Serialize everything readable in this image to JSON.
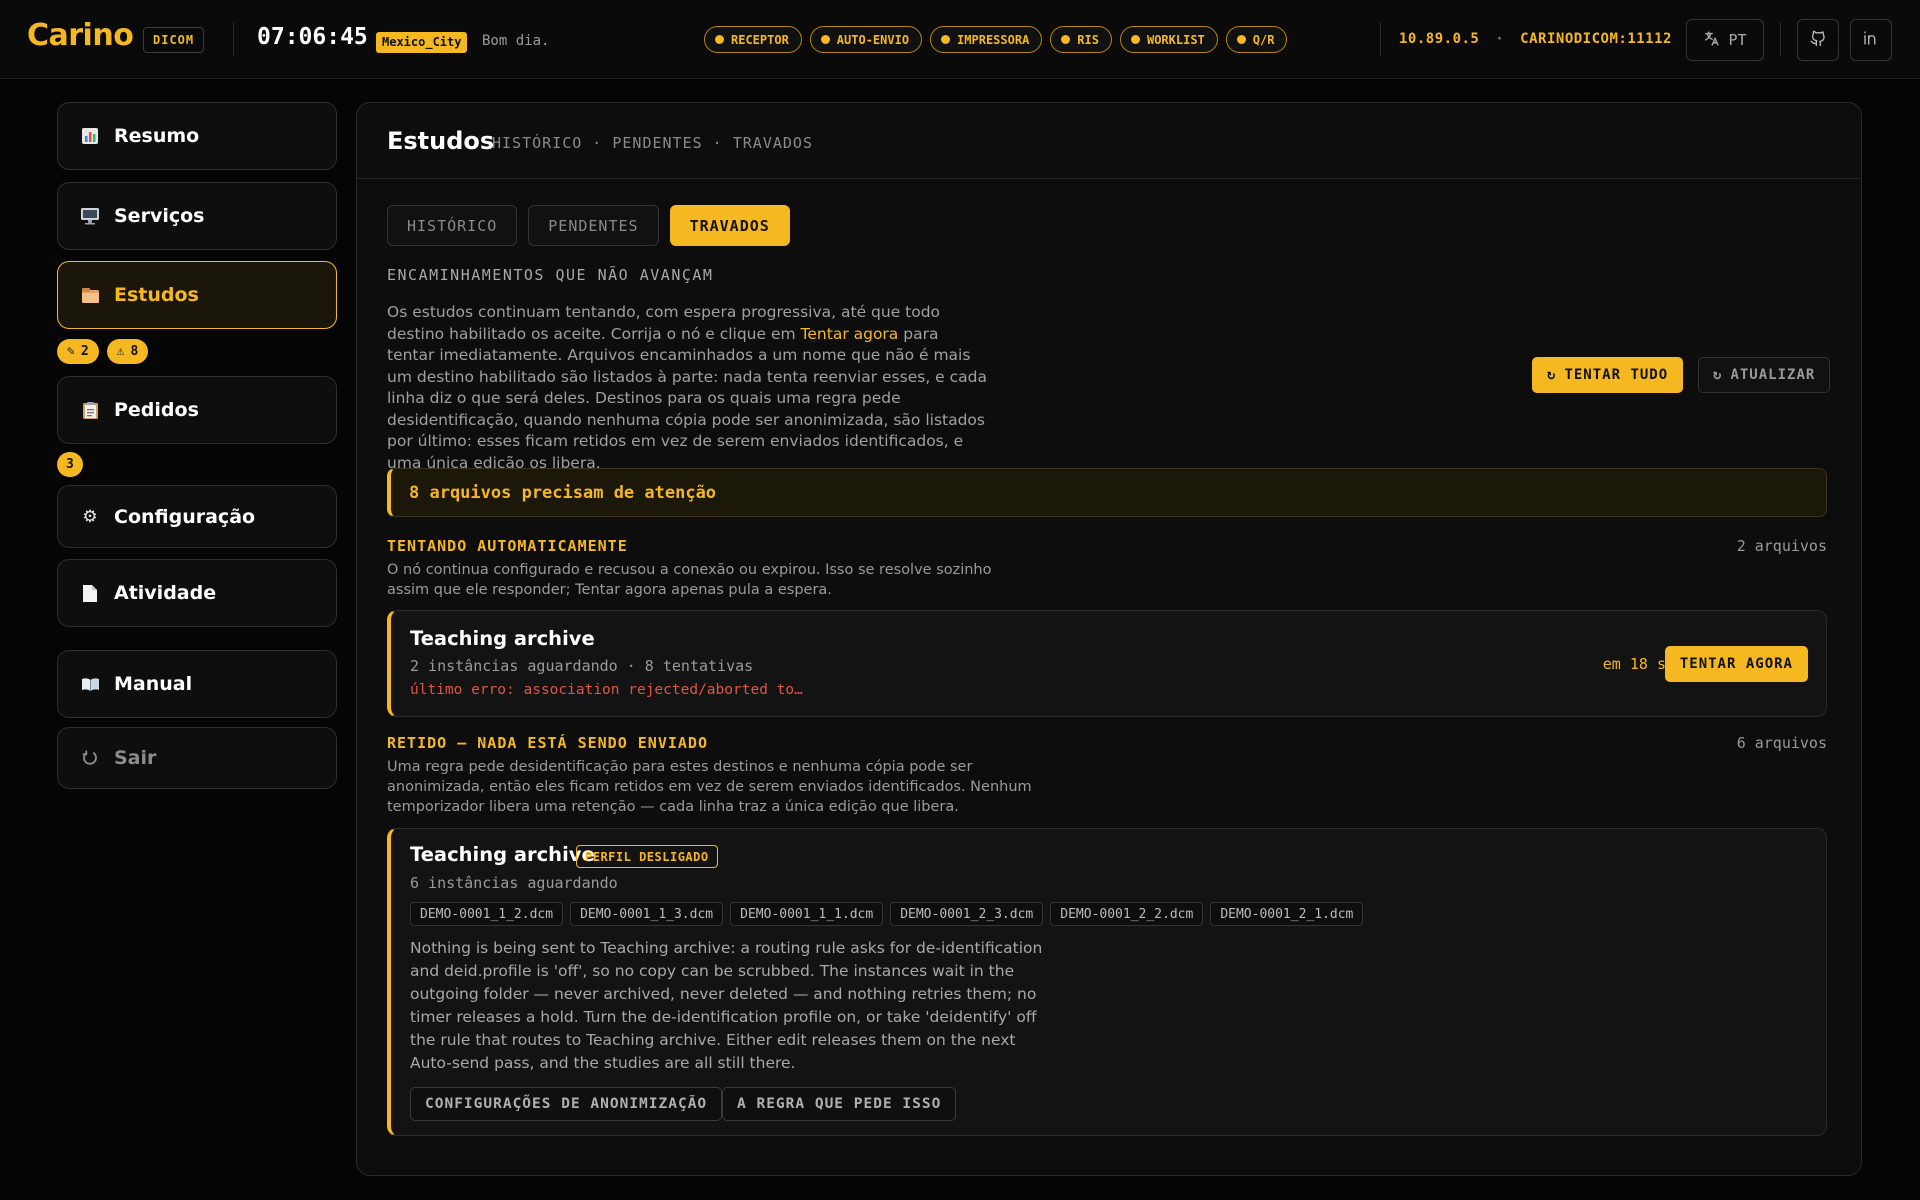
{
  "app": {
    "brand": "Carino",
    "brand_tag": "DICOM",
    "clock": "07:06:45",
    "timezone": "Mexico_City",
    "greeting": "Bom dia.",
    "address": "10.89.0.5",
    "address_sep": "·",
    "ae_title": "CARINODICOM:11112",
    "language": "PT",
    "accent_color": "#f5b820",
    "error_color": "#e05540"
  },
  "status_pills": [
    {
      "label": "RECEPTOR"
    },
    {
      "label": "AUTO-ENVIO"
    },
    {
      "label": "IMPRESSORA"
    },
    {
      "label": "RIS"
    },
    {
      "label": "WORKLIST"
    },
    {
      "label": "Q/R"
    }
  ],
  "sidebar": {
    "items": [
      {
        "label": "Resumo",
        "icon": "bar-chart-icon"
      },
      {
        "label": "Serviços",
        "icon": "monitor-icon"
      },
      {
        "label": "Estudos",
        "icon": "folder-icon"
      },
      {
        "label": "Pedidos",
        "icon": "clipboard-icon"
      },
      {
        "label": "Configuração",
        "icon": "gear-icon"
      },
      {
        "label": "Atividade",
        "icon": "document-icon"
      },
      {
        "label": "Manual",
        "icon": "book-icon"
      },
      {
        "label": "Sair",
        "icon": "power-icon"
      }
    ],
    "estudos_badges": [
      {
        "icon": "pencil-icon",
        "count": "2"
      },
      {
        "icon": "warning-icon",
        "count": "8"
      }
    ],
    "pedidos_badge": "3"
  },
  "main": {
    "title": "Estudos",
    "subtitle": "HISTÓRICO · PENDENTES · TRAVADOS",
    "tabs": [
      {
        "label": "HISTÓRICO"
      },
      {
        "label": "PENDENTES"
      },
      {
        "label": "TRAVADOS"
      }
    ],
    "active_tab": "TRAVADOS",
    "section_caption": "ENCAMINHAMENTOS QUE NÃO AVANÇAM",
    "intro_before": "Os estudos continuam tentando, com espera progressiva, até que todo destino habilitado os aceite. Corrija o nó e clique em ",
    "intro_link": "Tentar agora",
    "intro_after": " para tentar imediatamente. Arquivos encaminhados a um nome que não é mais um destino habilitado são listados à parte: nada tenta reenviar esses, e cada linha diz o que será deles. Destinos para os quais uma regra pede desidentificação, quando nenhuma cópia pode ser anonimizada, são listados por último: esses ficam retidos em vez de serem enviados identificados, e uma única edição os libera.",
    "retry_all": "TENTAR TUDO",
    "refresh": "ATUALIZAR",
    "attention": "8 arquivos precisam de atenção",
    "auto_group": {
      "title": "TENTANDO AUTOMATICAMENTE",
      "count": "2 arquivos",
      "desc": "O nó continua configurado e recusou a conexão ou expirou. Isso se resolve sozinho assim que ele responder; Tentar agora apenas pula a espera.",
      "card": {
        "name": "Teaching archive",
        "meta": "2 instâncias aguardando · 8 tentativas",
        "error": "último erro: association rejected/aborted to…",
        "eta": "em 18 s",
        "action": "TENTAR AGORA"
      }
    },
    "held_group": {
      "title": "RETIDO — NADA ESTÁ SENDO ENVIADO",
      "count": "6 arquivos",
      "desc": "Uma regra pede desidentificação para estes destinos e nenhuma cópia pode ser anonimizada, então eles ficam retidos em vez de serem enviados identificados. Nenhum temporizador libera uma retenção — cada linha traz a única edição que libera.",
      "card": {
        "name": "Teaching archive",
        "tag": "PERFIL DESLIGADO",
        "meta": "6 instâncias aguardando",
        "files": [
          "DEMO-0001_1_2.dcm",
          "DEMO-0001_1_3.dcm",
          "DEMO-0001_1_1.dcm",
          "DEMO-0001_2_3.dcm",
          "DEMO-0001_2_2.dcm",
          "DEMO-0001_2_1.dcm"
        ],
        "body": "Nothing is being sent to Teaching archive: a routing rule asks for de-identification and deid.profile is 'off', so no copy can be scrubbed. The instances wait in the outgoing folder — never archived, never deleted — and nothing retries them; no timer releases a hold. Turn the de-identification profile on, or take 'deidentify' off the rule that routes to Teaching archive. Either edit releases them on the next Auto-send pass, and the studies are all still there.",
        "btn_deid": "CONFIGURAÇÕES DE ANONIMIZAÇÃO",
        "btn_rule": "A REGRA QUE PEDE ISSO"
      }
    }
  }
}
